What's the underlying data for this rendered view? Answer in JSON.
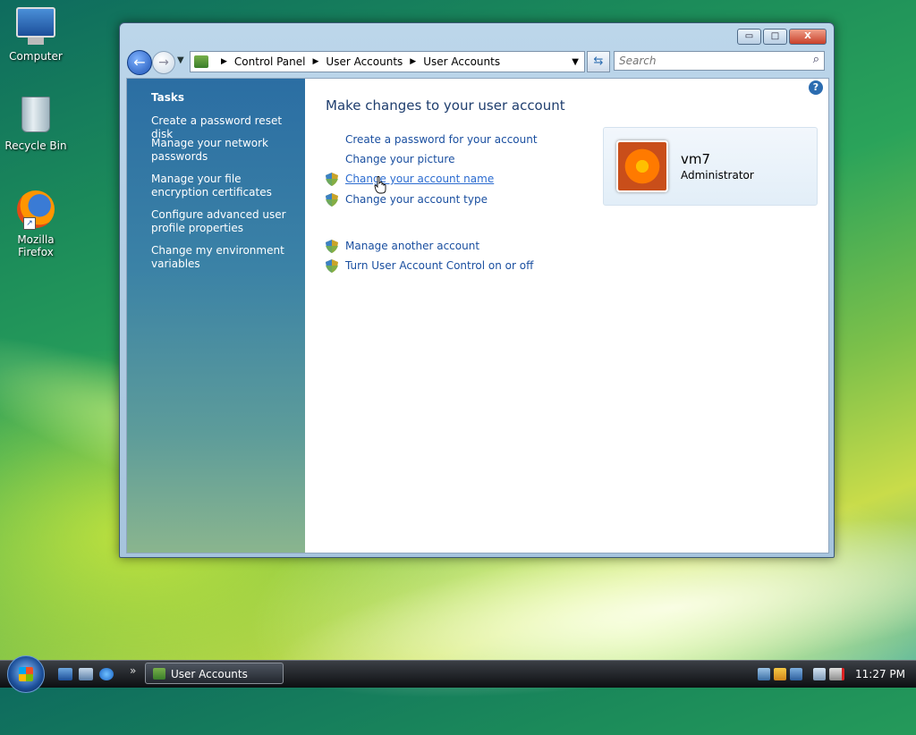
{
  "desktop": {
    "icons": [
      {
        "label": "Computer"
      },
      {
        "label": "Recycle Bin"
      },
      {
        "label": "Mozilla Firefox"
      }
    ]
  },
  "window": {
    "buttons": {
      "minimize": "▭",
      "maximize": "□",
      "close": "X"
    },
    "address": {
      "crumbs": [
        "Control Panel",
        "User Accounts",
        "User Accounts"
      ]
    },
    "search": {
      "placeholder": "Search"
    },
    "sidebar": {
      "heading": "Tasks",
      "tasks": [
        "Create a password reset disk",
        "Manage your network passwords",
        "Manage your file encryption certificates",
        "Configure advanced user profile properties",
        "Change my environment variables"
      ]
    },
    "main": {
      "title": "Make changes to your user account",
      "links": [
        {
          "label": "Create a password for your account",
          "shield": false
        },
        {
          "label": "Change your picture",
          "shield": false
        },
        {
          "label": "Change your account name",
          "shield": true,
          "hover": true
        },
        {
          "label": "Change your account type",
          "shield": true
        },
        {
          "label": "Manage another account",
          "shield": true
        },
        {
          "label": "Turn User Account Control on or off",
          "shield": true
        }
      ],
      "user": {
        "name": "vm7",
        "role": "Administrator"
      },
      "help": "?"
    }
  },
  "taskbar": {
    "active_task": "User Accounts",
    "clock": "11:27 PM",
    "chevron": "»"
  },
  "colors": {
    "link": "#1a4fa0",
    "title": "#1f3e6e",
    "sidebar_top": "#2b6ea3"
  }
}
